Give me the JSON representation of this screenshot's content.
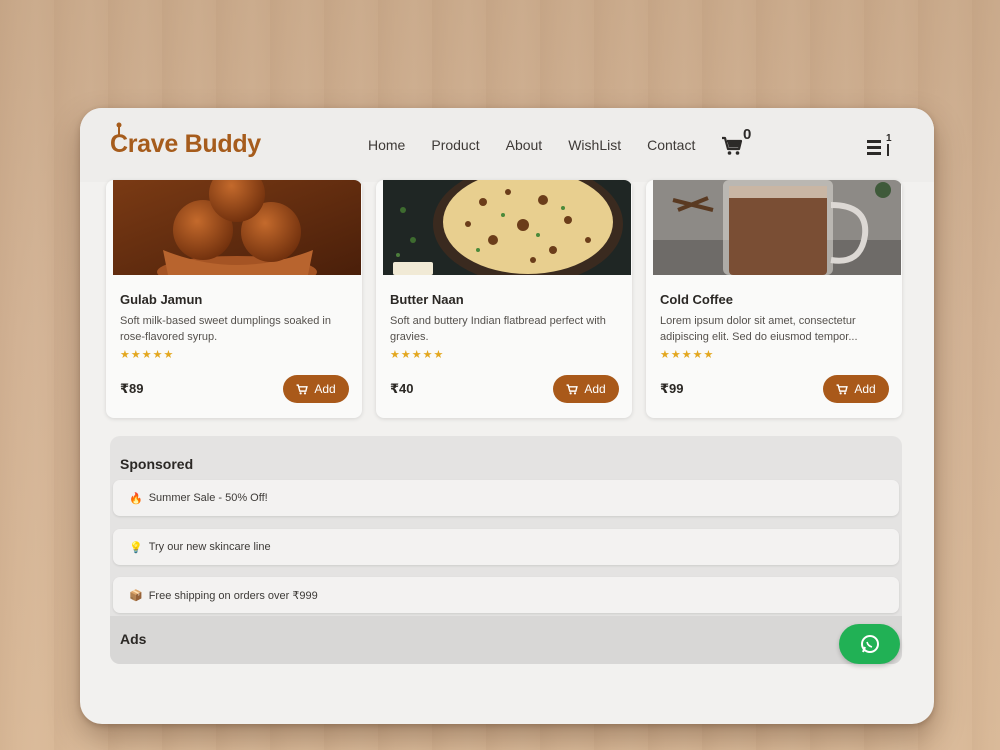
{
  "brand": {
    "name": "Crave Buddy"
  },
  "nav": {
    "links": [
      "Home",
      "Product",
      "About",
      "WishList",
      "Contact"
    ],
    "cart_count": "0",
    "menu_badge": "1"
  },
  "products": [
    {
      "title": "Gulab Jamun",
      "description": "Soft milk-based sweet dumplings soaked in rose-flavored syrup.",
      "stars": "★★★★★",
      "price": "₹89",
      "add_label": "Add",
      "image": "gulab-jamun-photo"
    },
    {
      "title": "Butter Naan",
      "description": "Soft and buttery Indian flatbread perfect with gravies.",
      "stars": "★★★★★",
      "price": "₹40",
      "add_label": "Add",
      "image": "butter-naan-photo"
    },
    {
      "title": "Cold Coffee",
      "description": "Lorem ipsum dolor sit amet, consectetur adipiscing elit. Sed do eiusmod tempor...",
      "stars": "★★★★★",
      "price": "₹99",
      "add_label": "Add",
      "image": "cold-coffee-photo"
    }
  ],
  "sponsored": {
    "title": "Sponsored",
    "items": [
      {
        "icon": "🔥",
        "text": "Summer Sale - 50% Off!"
      },
      {
        "icon": "💡",
        "text": "Try our new skincare line"
      },
      {
        "icon": "📦",
        "text": "Free shipping on orders over ₹999"
      }
    ]
  },
  "ads": {
    "title": "Ads"
  },
  "colors": {
    "brand": "#a65c1c",
    "button": "#a9591a",
    "chat": "#21b155",
    "stars": "#e3a720"
  }
}
